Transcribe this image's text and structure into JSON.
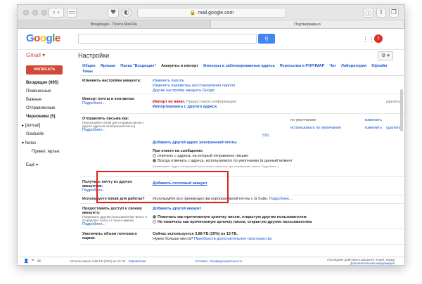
{
  "browser": {
    "url": "mail.google.com",
    "tabs": [
      "Входящие - Почта Mail.Ru",
      "Подтверждено"
    ]
  },
  "header": {
    "logo": "Google",
    "apps_icon": "grid-icon",
    "notification_count": "1"
  },
  "topbar": {
    "gmail_label": "Gmail ▾",
    "page_title": "Настройки",
    "gear_label": "⚙ ▾"
  },
  "sidebar": {
    "compose": "НАПИСАТЬ",
    "items": [
      {
        "label": "Входящие (695)",
        "bold": true
      },
      {
        "label": "Помеченные"
      },
      {
        "label": "Важные"
      },
      {
        "label": "Отправленные"
      },
      {
        "label": "Черновики (5)",
        "bold": true
      },
      {
        "label": "▸ [Airmail]"
      },
      {
        "label": "Gladuelle"
      },
      {
        "label": "▾ Notes"
      },
      {
        "label": "Привет, ярлык"
      },
      {
        "label": "Ещё ▾"
      }
    ]
  },
  "tabs": [
    "Общие",
    "Ярлыки",
    "Папка \"Входящие\"",
    "Аккаунты и импорт",
    "Фильтры и заблокированные адреса",
    "Пересылка и POP/IMAP",
    "Чат",
    "Лаборатория",
    "Офлайн",
    "Темы"
  ],
  "current_tab": "Аккаунты и импорт",
  "sections": {
    "change_settings": {
      "label": "Изменить настройки аккаунта:",
      "links": [
        "Изменить пароль",
        "Изменить параметры восстановления пароля",
        "Другие настройки аккаунта Google"
      ]
    },
    "import": {
      "label": "Импорт почты и контактов:",
      "more": "Подробнее...",
      "status": "Импорт не начат.",
      "status_tail": "Предоставить информацию",
      "action": "Импортировать с другого адреса",
      "delete": "удалить"
    },
    "send_as": {
      "label": "Отправлять письма как:",
      "sub": "(Используйте Gmail для отправки писем с других адресов электронной почты)",
      "more": "Подробнее...",
      "default_text": "по умолчанию",
      "make_default": "использовать по умолчанию",
      "edit": "изменить",
      "delete": "удалить",
      "ssl": "SSL",
      "add": "Добавить другой адрес электронной почты",
      "reply_head": "При ответе на сообщение:",
      "reply_opt1": "отвечать с адреса, на который отправлено письмо",
      "reply_opt2": "Всегда отвечать с адреса, используемого по умолчанию (в данный момент",
      "reply_note": "(Примечание. Адрес электронной почты можно изменить при отправлении ответа. Подробнее...)"
    },
    "check_mail": {
      "label": "Получать почту из других аккаунтов:",
      "more": "Подробнее...",
      "action": "Добавить почтовый аккаунт"
    },
    "gsuite": {
      "label": "Используете Gmail для работы?",
      "text": "Используйте все преимущества корпоративной почты с G Suite.",
      "more": "Подробнее..."
    },
    "grant_access": {
      "label": "Предоставить доступ к своему аккаунту:",
      "sub": "(Разрешить другим пользователям читать и отправлять почту от своего имени)",
      "more": "Подробнее...",
      "action": "Добавить другой аккаунт",
      "opt1": "Помечать как прочитанную цепочку писем, открытую другим пользователем",
      "opt2": "Не помечать как прочитанную цепочку писем, открытую другим пользователем"
    },
    "storage": {
      "label": "Увеличить объем почтового ящика:",
      "used": "Сейчас используется 3,88 ГБ (25%) из 15 ГБ.",
      "need": "Нужно больше места?",
      "buy": "Приобрести дополнительное пространство"
    }
  },
  "footer": {
    "usage": "Использовано 3,88 ГБ (25%) из 15 ГБ",
    "manage": "Управление",
    "terms": "Условия · Конфиденциальность",
    "activity": "Последние действия в аккаунте: 6 мин. назад",
    "details": "Дополнительная информация"
  }
}
